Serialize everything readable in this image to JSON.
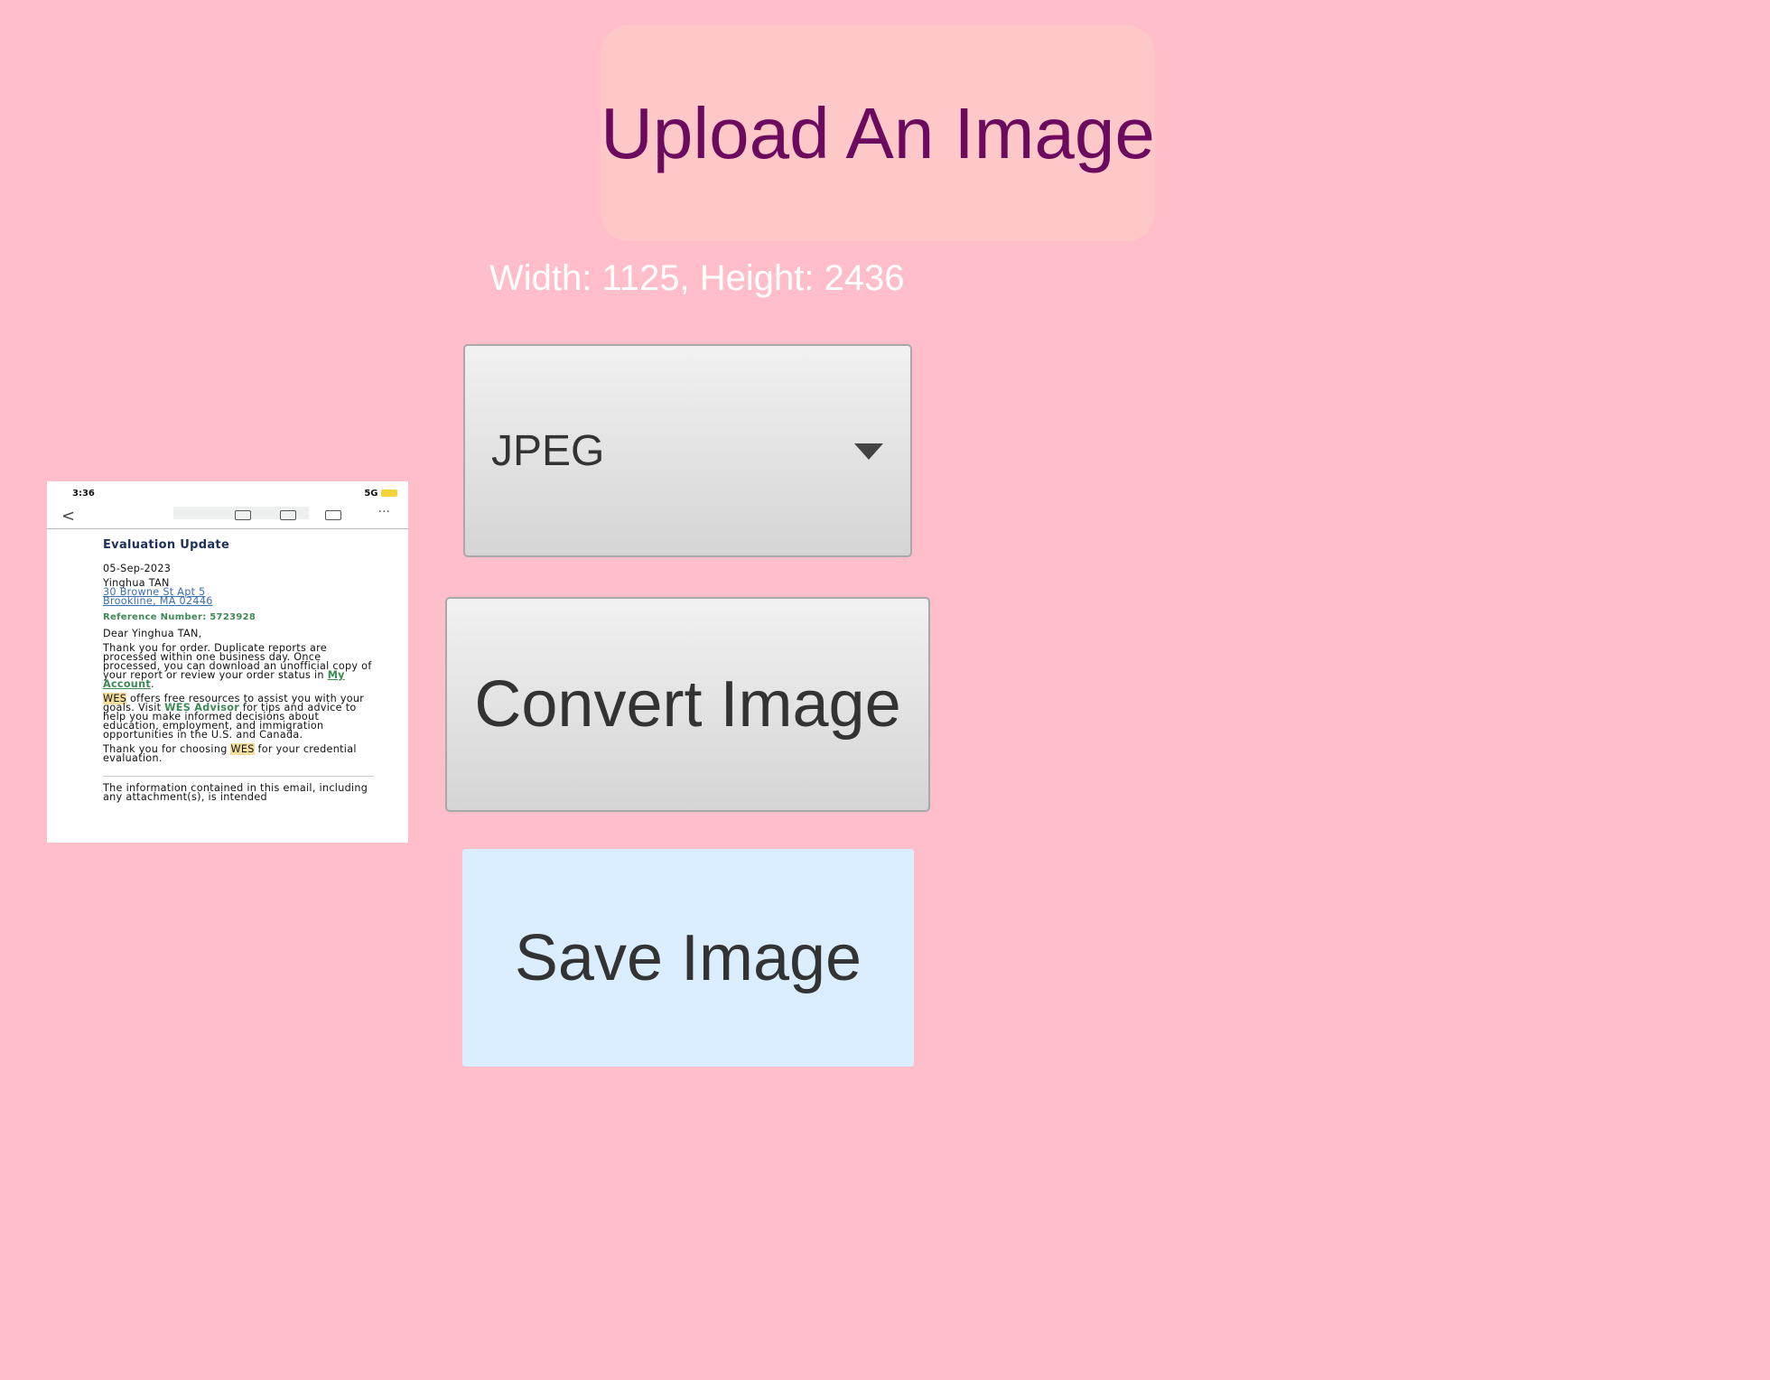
{
  "upload": {
    "label": "Upload An Image"
  },
  "dimensions": {
    "text": "Width: 1125, Height: 2436"
  },
  "format_select": {
    "selected": "JPEG"
  },
  "convert": {
    "label": "Convert Image"
  },
  "save": {
    "label": "Save Image"
  },
  "preview": {
    "status_time": "3:36",
    "status_icons": "5G",
    "title": "Evaluation Update",
    "date": "05-Sep-2023",
    "name": "Yinghua TAN",
    "address_line1": "30 Browne St Apt 5",
    "address_line2": "Brookline, MA 02446",
    "reference": "Reference Number: 5723928",
    "greeting": "Dear Yinghua TAN,",
    "para1": "Thank you for order. Duplicate reports are processed within one business day. Once processed, you can download an unofficial copy of your report or review your order status in",
    "my_account": "My Account",
    "para2_wes": "WES",
    "para2_a": " offers free resources to assist you with your goals. Visit ",
    "para2_wes_advisor": "WES Advisor",
    "para2_b": " for tips and advice to help you make informed decisions about education, employment, and immigration opportunities in the U.S. and Canada.",
    "para3_a": "Thank you for choosing ",
    "para3_wes": "WES",
    "para3_b": " for your credential evaluation.",
    "footer": "The information contained in this email, including any attachment(s), is intended"
  }
}
